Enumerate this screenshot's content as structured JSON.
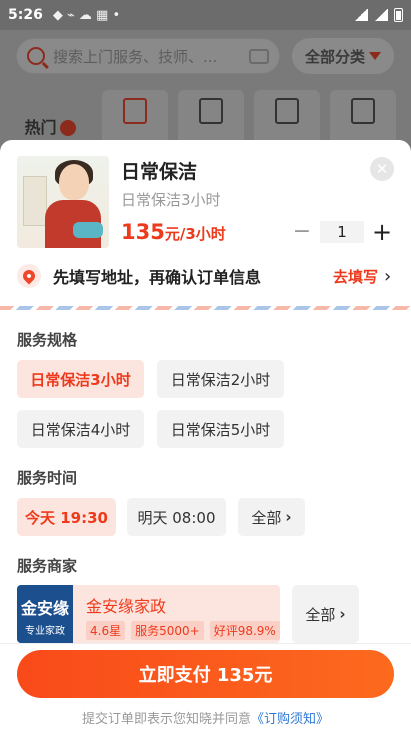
{
  "status_bar": {
    "time": "5:26"
  },
  "background": {
    "search_placeholder": "搜索上门服务、技师、...",
    "all_categories": "全部分类",
    "hot_label": "热门"
  },
  "product": {
    "title": "日常保洁",
    "subtitle": "日常保洁3小时",
    "price": "135",
    "price_unit": "元/3小时",
    "quantity": "1",
    "minus": "−",
    "plus": "+"
  },
  "address": {
    "prompt": "先填写地址，再确认订单信息",
    "action": "去填写",
    "chevron": "›"
  },
  "spec": {
    "title": "服务规格",
    "options": [
      "日常保洁3小时",
      "日常保洁2小时",
      "日常保洁4小时",
      "日常保洁5小时"
    ],
    "selected_index": 0
  },
  "time": {
    "title": "服务时间",
    "options": [
      "今天 19:30",
      "明天 08:00"
    ],
    "all_label": "全部",
    "selected_index": 0
  },
  "merchant": {
    "title": "服务商家",
    "logo_line1": "金安缘",
    "logo_line2": "专业家政",
    "name": "金安缘家政",
    "rating": "4.6星",
    "services": "服务5000+",
    "praise": "好评98.9%",
    "all_label": "全部"
  },
  "footer": {
    "pay_label": "立即支付 135元",
    "agree_text": "提交订单即表示您知晓并同意",
    "agree_link": "《订购须知》"
  },
  "colors": {
    "accent": "#ee3a1c",
    "accent_bg": "#fde5df",
    "link": "#2f78d6"
  }
}
